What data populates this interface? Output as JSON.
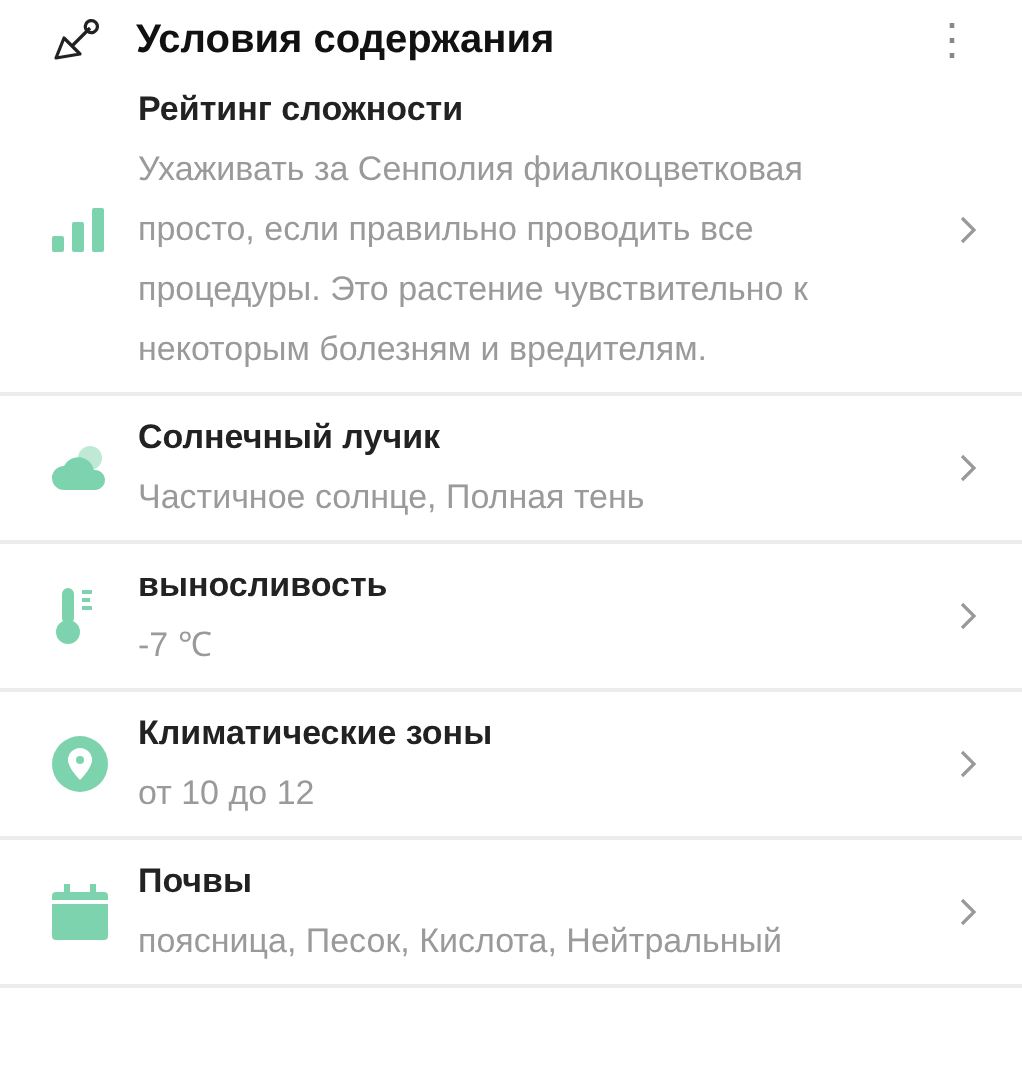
{
  "header": {
    "title": "Условия содержания",
    "menu_icon": "⋮"
  },
  "rows": [
    {
      "kind": "bars",
      "title": "Рейтинг сложности",
      "subtitle": "Ухаживать за Сенполия фиалкоцветковая просто, если правильно проводить все процедуры. Это растение чувствительно к некоторым болезням и вредителям."
    },
    {
      "kind": "cloud",
      "title": "Солнечный лучик",
      "subtitle": "Частичное солнце, Полная тень"
    },
    {
      "kind": "thermometer",
      "title": "выносливость",
      "subtitle": "-7 ℃"
    },
    {
      "kind": "pin",
      "title": "Климатические зоны",
      "subtitle": "от 10 до 12"
    },
    {
      "kind": "calendar",
      "title": "Почвы",
      "subtitle": "поясница, Песок, Кислота, Нейтральный"
    }
  ]
}
